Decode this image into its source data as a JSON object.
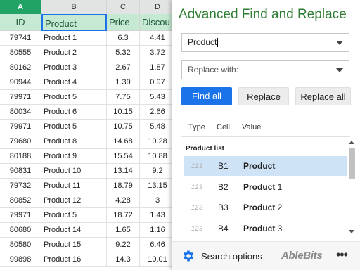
{
  "sheet": {
    "col_letters": [
      "A",
      "B",
      "C",
      "D"
    ],
    "header": {
      "id": "ID",
      "product": "Product",
      "price": "Price",
      "discount": "Discou"
    },
    "rows": [
      {
        "id": "79741",
        "product": "Product 1",
        "price": "6.3",
        "discount": "4.41"
      },
      {
        "id": "80555",
        "product": "Product 2",
        "price": "5.32",
        "discount": "3.72"
      },
      {
        "id": "80162",
        "product": "Product 3",
        "price": "2.67",
        "discount": "1.87"
      },
      {
        "id": "90944",
        "product": "Product 4",
        "price": "1.39",
        "discount": "0.97"
      },
      {
        "id": "79971",
        "product": "Product 5",
        "price": "7.75",
        "discount": "5.43"
      },
      {
        "id": "80034",
        "product": "Product 6",
        "price": "10.15",
        "discount": "2.66"
      },
      {
        "id": "79971",
        "product": "Product 5",
        "price": "10.75",
        "discount": "5.48"
      },
      {
        "id": "79680",
        "product": "Product 8",
        "price": "14.68",
        "discount": "10.28"
      },
      {
        "id": "80188",
        "product": "Product 9",
        "price": "15.54",
        "discount": "10.88"
      },
      {
        "id": "90831",
        "product": "Product 10",
        "price": "13.14",
        "discount": "9.2"
      },
      {
        "id": "79732",
        "product": "Product 11",
        "price": "18.79",
        "discount": "13.15"
      },
      {
        "id": "80852",
        "product": "Product 12",
        "price": "4.28",
        "discount": "3"
      },
      {
        "id": "79971",
        "product": "Product 5",
        "price": "18.72",
        "discount": "1.43"
      },
      {
        "id": "80680",
        "product": "Product 14",
        "price": "1.65",
        "discount": "1.16"
      },
      {
        "id": "80580",
        "product": "Product 15",
        "price": "9.22",
        "discount": "6.46"
      },
      {
        "id": "99898",
        "product": "Product 16",
        "price": "14.3",
        "discount": "10.01"
      }
    ]
  },
  "panel": {
    "title": "Advanced Find and Replace",
    "find_value": "Product",
    "replace_placeholder": "Replace with:",
    "buttons": {
      "find_all": "Find all",
      "replace": "Replace",
      "replace_all": "Replace all"
    },
    "results_header": {
      "type": "Type",
      "cell": "Cell",
      "value": "Value"
    },
    "group_label": "Product list",
    "results": [
      {
        "type": "123",
        "cell": "B1",
        "match": "Product",
        "rest": "",
        "selected": true
      },
      {
        "type": "123",
        "cell": "B2",
        "match": "Product",
        "rest": " 1",
        "selected": false
      },
      {
        "type": "123",
        "cell": "B3",
        "match": "Product",
        "rest": " 2",
        "selected": false
      },
      {
        "type": "123",
        "cell": "B4",
        "match": "Product",
        "rest": " 3",
        "selected": false
      }
    ],
    "footer": {
      "options_label": "Search options",
      "brand": "AbleBits",
      "more": "•••"
    }
  },
  "colors": {
    "accent": "#1a73e8",
    "title_green": "#2e7d32",
    "header_fill": "#c5e9d2",
    "selected_col": "#21a366",
    "result_selected": "#cfe3f7"
  }
}
